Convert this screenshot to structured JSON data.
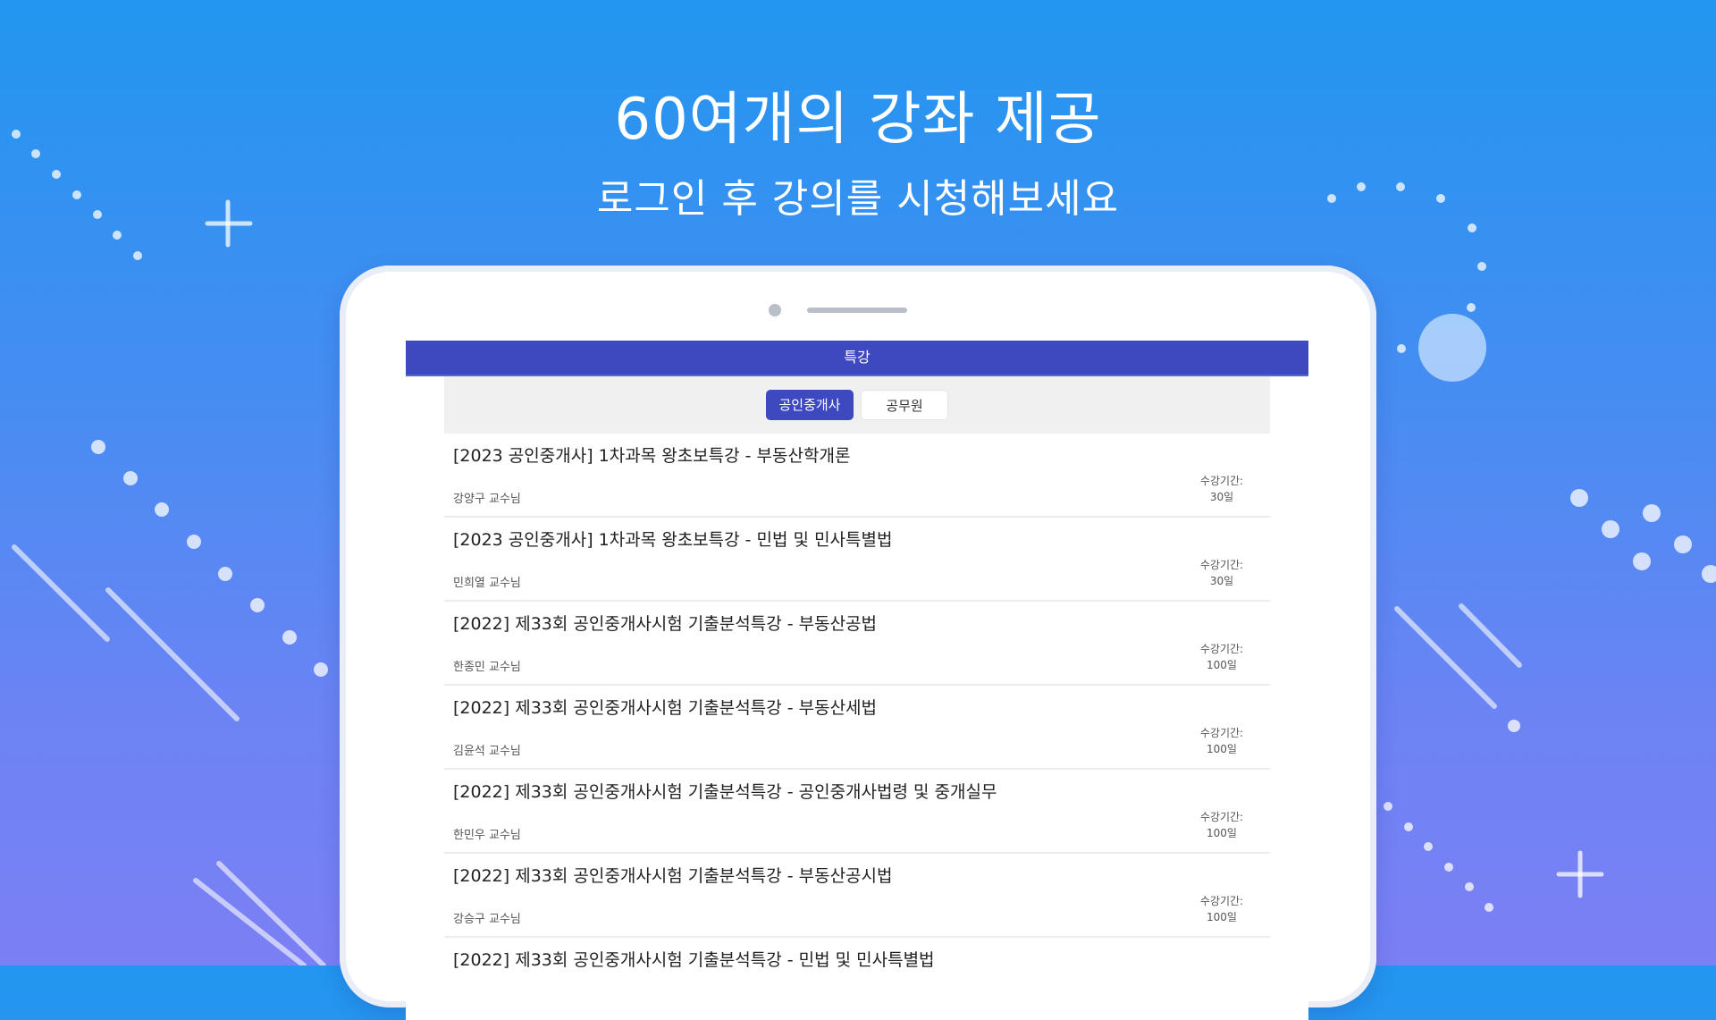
{
  "hero": {
    "title": "60여개의 강좌 제공",
    "subtitle": "로그인 후 강의를 시청해보세요"
  },
  "app": {
    "header_title": "특강",
    "tabs": [
      {
        "label": "공인중개사",
        "active": true
      },
      {
        "label": "공무원",
        "active": false
      }
    ],
    "period_label": "수강기간:",
    "courses": [
      {
        "title": "[2023 공인중개사] 1차과목 왕초보특강 - 부동산학개론",
        "teacher": "강양구 교수님",
        "period": "30일"
      },
      {
        "title": "[2023 공인중개사] 1차과목 왕초보특강 - 민법 및 민사특별법",
        "teacher": "민희열 교수님",
        "period": "30일"
      },
      {
        "title": "[2022] 제33회 공인중개사시험 기출분석특강 - 부동산공법",
        "teacher": "한종민 교수님",
        "period": "100일"
      },
      {
        "title": "[2022] 제33회 공인중개사시험 기출분석특강 - 부동산세법",
        "teacher": "김윤석 교수님",
        "period": "100일"
      },
      {
        "title": "[2022] 제33회 공인중개사시험 기출분석특강 - 공인중개사법령 및 중개실무",
        "teacher": "한민우 교수님",
        "period": "100일"
      },
      {
        "title": "[2022] 제33회 공인중개사시험 기출분석특강 - 부동산공시법",
        "teacher": "강승구 교수님",
        "period": "100일"
      },
      {
        "title": "[2022] 제33회 공인중개사시험 기출분석특강 - 민법 및 민사특별법",
        "teacher": "",
        "period": ""
      }
    ]
  },
  "colors": {
    "accent": "#3e49c0",
    "background_top": "#2196f0",
    "background_bottom": "#7b80f4"
  }
}
